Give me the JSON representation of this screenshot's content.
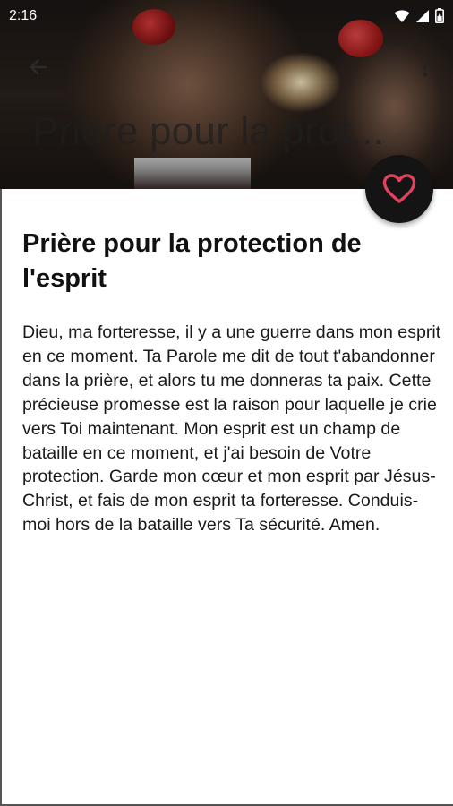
{
  "status_bar": {
    "time": "2:16"
  },
  "header": {
    "title_overlay": "Prière pour la prot..."
  },
  "article": {
    "title": "Prière pour la protection de l'esprit",
    "body": "Dieu, ma forteresse, il y a une guerre dans mon esprit en ce moment. Ta Parole me dit de tout t'abandonner dans la prière, et alors tu me donneras ta paix. Cette précieuse promesse est la raison pour laquelle je crie vers Toi maintenant. Mon esprit est un champ de bataille en ce moment, et j'ai besoin de Votre protection. Garde mon cœur et mon esprit par Jésus-Christ, et fais de mon esprit ta forteresse. Conduis-moi hors de la bataille vers Ta sécurité. Amen."
  },
  "colors": {
    "fab_background": "#141414",
    "heart_accent": "#e0435e"
  },
  "icons": {
    "back": "arrow-back-icon",
    "more": "more-vert-icon",
    "favorite": "heart-outline-icon",
    "wifi": "wifi-icon",
    "signal": "signal-icon",
    "battery": "battery-icon"
  }
}
